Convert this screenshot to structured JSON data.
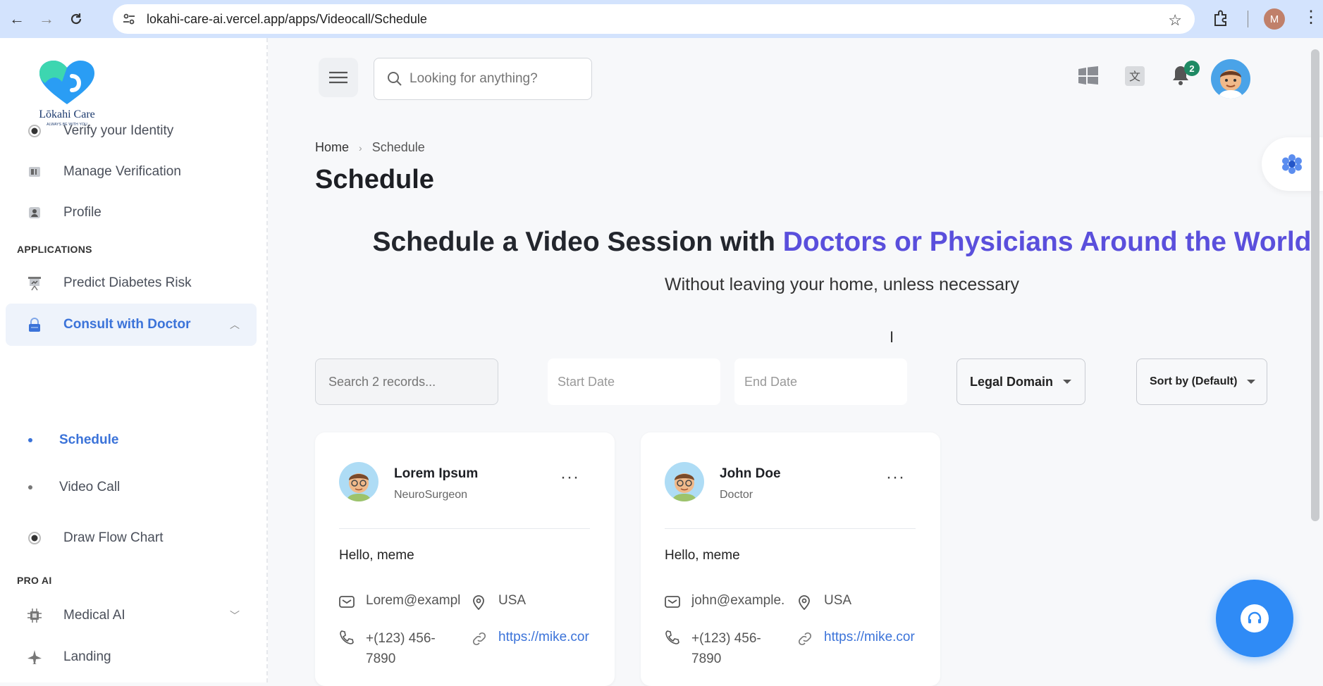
{
  "browser": {
    "url": "lokahi-care-ai.vercel.app/apps/Videocall/Schedule",
    "profile_initial": "M"
  },
  "brand": {
    "name": "Lōkahi Care",
    "tagline": "ALWAYS BE WITH YOU"
  },
  "sidebar": {
    "items": [
      {
        "label": "Verify your Identity",
        "icon": "radio-icon"
      },
      {
        "label": "Manage Verification",
        "icon": "id-card-icon"
      },
      {
        "label": "Profile",
        "icon": "user-card-icon"
      }
    ],
    "section_applications": "APPLICATIONS",
    "apps": [
      {
        "label": "Predict Diabetes Risk",
        "icon": "presentation-icon"
      },
      {
        "label": "Consult with Doctor",
        "icon": "lock-icon"
      }
    ],
    "sub_items": [
      {
        "label": "Schedule"
      },
      {
        "label": "Video Call"
      }
    ],
    "flow": {
      "label": "Draw Flow Chart",
      "icon": "radio-icon"
    },
    "section_pro": "PRO AI",
    "pro": [
      {
        "label": "Medical AI",
        "icon": "chip-icon"
      },
      {
        "label": "Landing",
        "icon": "plane-icon"
      }
    ]
  },
  "header": {
    "search_placeholder": "Looking for anything?",
    "notification_count": "2"
  },
  "breadcrumb": {
    "home": "Home",
    "current": "Schedule"
  },
  "page_title": "Schedule",
  "hero": {
    "title_prefix": "Schedule a Video Session with ",
    "title_highlight": "Doctors or Physicians Around the World",
    "subtitle": "Without leaving your home, unless necessary"
  },
  "filters": {
    "search_placeholder": "Search 2 records...",
    "start_date": "Start Date",
    "end_date": "End Date",
    "domain": "Legal Domain",
    "sort": "Sort by (Default)"
  },
  "cards": [
    {
      "name": "Lorem Ipsum",
      "role": "NeuroSurgeon",
      "message": "Hello, meme",
      "email": "Lorem@exampl",
      "location": "USA",
      "phone_line1": "+(123) 456-",
      "phone_line2": "7890",
      "website": "https://mike.cor"
    },
    {
      "name": "John Doe",
      "role": "Doctor",
      "message": "Hello, meme",
      "email": "john@example.",
      "location": "USA",
      "phone_line1": "+(123) 456-",
      "phone_line2": "7890",
      "website": "https://mike.cor"
    }
  ],
  "colors": {
    "accent": "#3b73d9",
    "highlight": "#5a4fdc",
    "fab": "#2f8bf6",
    "badge": "#1f8a64",
    "browser_bar": "#d3e3fd"
  }
}
